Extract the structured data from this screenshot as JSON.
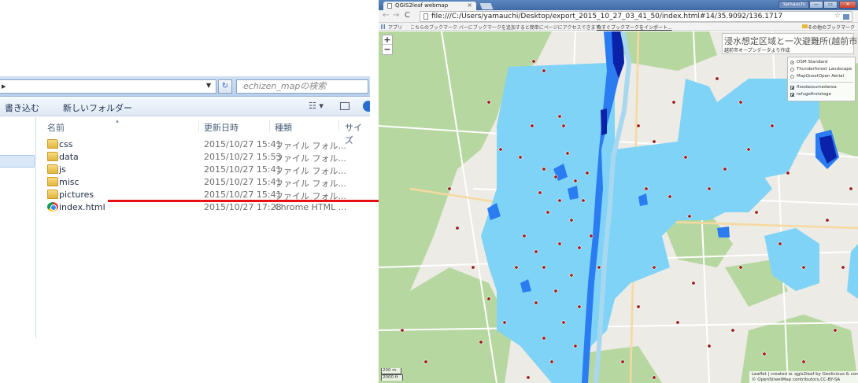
{
  "explorer": {
    "search_placeholder": "echizen_mapの検索",
    "toolbar": {
      "burn": "書き込む",
      "new_folder": "新しいフォルダー"
    },
    "columns": {
      "name": "名前",
      "modified": "更新日時",
      "type": "種類",
      "size": "サイズ"
    },
    "files": [
      {
        "name": "css",
        "modified": "2015/10/27 15:41",
        "type": "ファイル フォル...",
        "icon": "folder-icon"
      },
      {
        "name": "data",
        "modified": "2015/10/27 15:53",
        "type": "ファイル フォル...",
        "icon": "folder-icon"
      },
      {
        "name": "js",
        "modified": "2015/10/27 15:41",
        "type": "ファイル フォル...",
        "icon": "folder-icon"
      },
      {
        "name": "misc",
        "modified": "2015/10/27 15:41",
        "type": "ファイル フォル...",
        "icon": "folder-icon"
      },
      {
        "name": "pictures",
        "modified": "2015/10/27 15:41",
        "type": "ファイル フォル...",
        "icon": "folder-icon"
      },
      {
        "name": "index.html",
        "modified": "2015/10/27 17:28",
        "type": "Chrome HTML ...",
        "icon": "chrome-icon"
      }
    ]
  },
  "browser": {
    "tab_title": "QGIS2leaf webmap",
    "tab_close": "×",
    "user_label": "Yamauchi",
    "url": "file:///C:/Users/yamauchi/Desktop/export_2015_10_27_03_41_50/index.html#14/35.9092/136.1717",
    "bookmarks": {
      "apps": "アプリ",
      "message": "こちらのブックマーク バーにブックマークを追加すると簡単にページにアクセスできます。",
      "import_link": "今すぐブックマークをインポート...",
      "other": "その他のブックマーク"
    }
  },
  "map": {
    "title": "浸水想定区域と一次避難所(越前市)",
    "subtitle": "越前市オープンデータより作成",
    "zoom_in": "+",
    "zoom_out": "−",
    "base_layers": [
      {
        "label": "OSM Standard",
        "checked": true
      },
      {
        "label": "Thunderforest Landscape",
        "checked": false
      },
      {
        "label": "MapQuestOpen Aerial",
        "checked": false
      }
    ],
    "overlays": [
      {
        "label": "floodassumedarea",
        "checked": true
      },
      {
        "label": "refugefirststage",
        "checked": true
      }
    ],
    "scale": {
      "metric": "200 m",
      "imperial": "2000 ft"
    },
    "attribution_line1": "Leaflet | created w. qgis2leaf by Geolicious & contributors",
    "attribution_line2": "© OpenStreetMap contributors,CC-BY-SA",
    "colors": {
      "flood_light": "#7fd3f7",
      "flood_mid": "#2a7cf0",
      "flood_deep": "#0a22a8",
      "refuge": "#9b1a1a",
      "forest": "#b7d7a0"
    }
  }
}
